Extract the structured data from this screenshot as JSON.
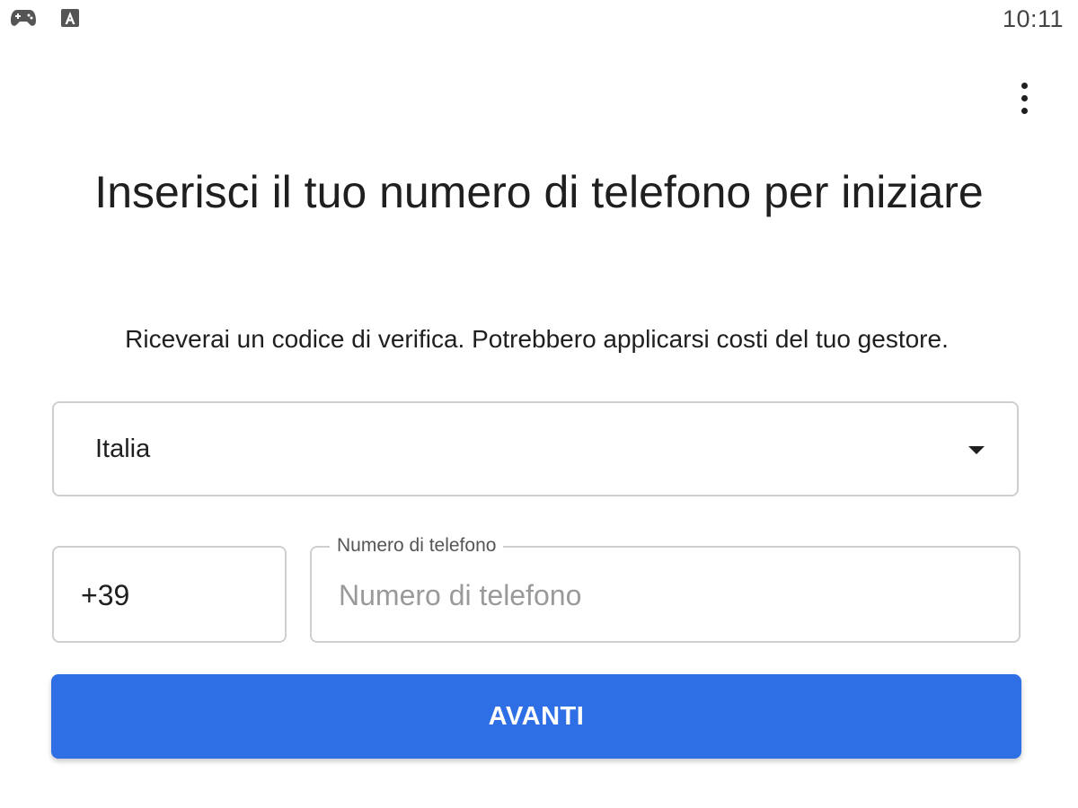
{
  "status_bar": {
    "time": "10:11",
    "icons": [
      "gamepad-icon",
      "font-a-icon"
    ]
  },
  "toolbar": {
    "overflow_icon": "more-vert-icon"
  },
  "main": {
    "title": "Inserisci il tuo numero di telefono per iniziare",
    "subtitle": "Riceverai un codice di verifica. Potrebbero applicarsi costi del tuo gestore.",
    "country_select": {
      "value": "Italia",
      "icon": "arrow-drop-down-icon"
    },
    "country_code": {
      "value": "+39"
    },
    "phone_field": {
      "label": "Numero di telefono",
      "placeholder": "Numero di telefono",
      "value": ""
    },
    "next_button": {
      "label": "AVANTI"
    }
  },
  "colors": {
    "accent": "#2f6fe6",
    "border": "#cfcfcf",
    "text": "#1f1f1f",
    "placeholder": "#9a9a9a"
  }
}
